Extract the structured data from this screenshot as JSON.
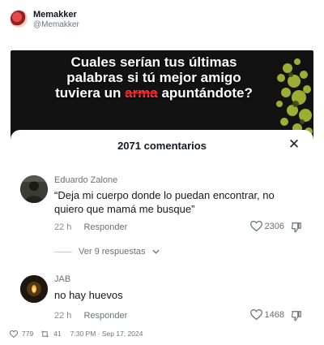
{
  "author": {
    "name": "Memakker",
    "handle": "@Memakker"
  },
  "video": {
    "caption_before": "Cuales serían tus últimas palabras si tú mejor amigo tuviera un ",
    "caption_struck": "arma",
    "caption_after": " apuntándote?"
  },
  "comments_panel": {
    "title": "2071 comentarios",
    "close_icon": "close-icon",
    "comments": [
      {
        "author": "Eduardo Zalone",
        "text": "“Deja mi cuerpo donde lo puedan encontrar, no quiero que mamá me busque”",
        "time": "22 h",
        "reply_label": "Responder",
        "likes": "2306",
        "replies_label": "Ver 9 respuestas"
      },
      {
        "author": "JAB",
        "text": "no hay huevos",
        "time": "22 h",
        "reply_label": "Responder",
        "likes": "1468"
      }
    ]
  },
  "footer": {
    "likes": "779",
    "reposts": "41",
    "timestamp": "7:30 PM · Sep 17, 2024"
  },
  "colors": {
    "caption_strike": "#ff3a3a",
    "video_bg": "#121212",
    "muted_text": "#6b6f78"
  }
}
